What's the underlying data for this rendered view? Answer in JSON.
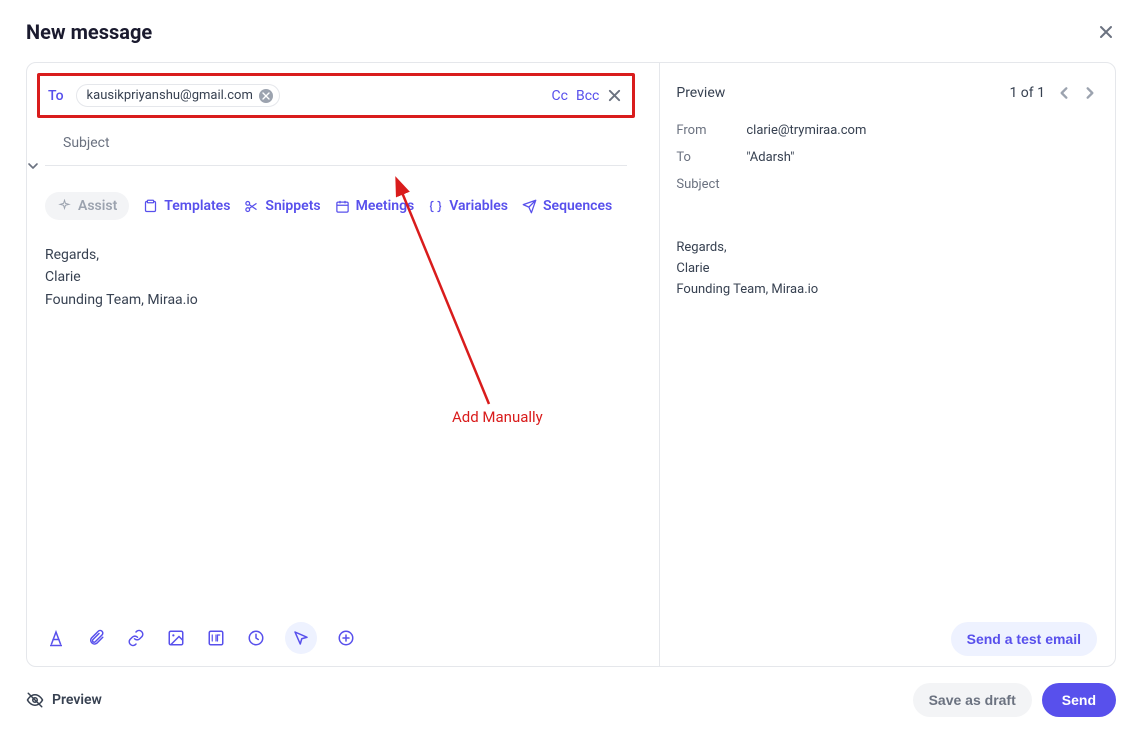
{
  "header": {
    "title": "New message"
  },
  "compose": {
    "to_label": "To",
    "recipient": "kausikpriyanshu@gmail.com",
    "cc_label": "Cc",
    "bcc_label": "Bcc",
    "subject_placeholder": "Subject",
    "body_line1": "Regards,",
    "body_line2": "Clarie",
    "body_line3": "Founding Team, Miraa.io"
  },
  "toolbar": {
    "assist": "Assist",
    "templates": "Templates",
    "snippets": "Snippets",
    "meetings": "Meetings",
    "variables": "Variables",
    "sequences": "Sequences"
  },
  "annotation": {
    "text": "Add Manually"
  },
  "preview": {
    "title": "Preview",
    "pager": "1 of 1",
    "from_label": "From",
    "from_value": "clarie@trymiraa.com",
    "to_label": "To",
    "to_value": "\"Adarsh\"",
    "subject_label": "Subject",
    "body_line1": "Regards,",
    "body_line2": "Clarie",
    "body_line3": "Founding Team, Miraa.io",
    "test_btn": "Send a test email"
  },
  "footer": {
    "preview_toggle": "Preview",
    "save_draft": "Save as draft",
    "send": "Send"
  }
}
